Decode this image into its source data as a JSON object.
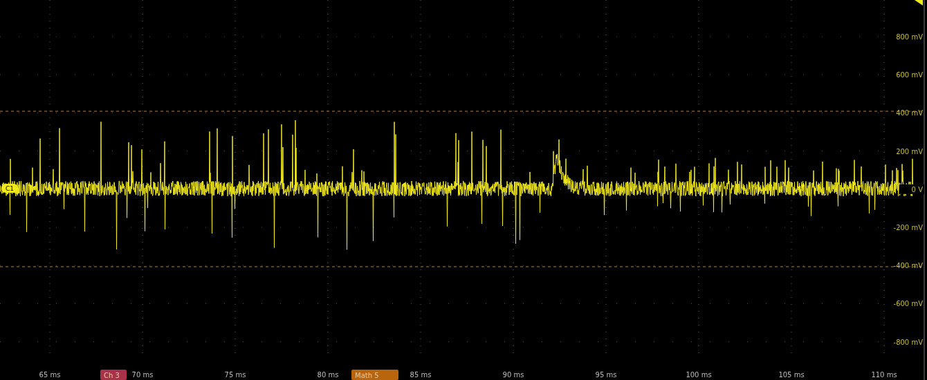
{
  "y_axis": {
    "ticks": [
      "800 mV",
      "600 mV",
      "400 mV",
      "200 mV",
      "0 V",
      "-200 mV",
      "-400 mV",
      "-600 mV",
      "-800 mV"
    ]
  },
  "x_axis": {
    "ticks": [
      "65 ms",
      "70 ms",
      "75 ms",
      "80 ms",
      "85 ms",
      "90 ms",
      "95 ms",
      "100 ms",
      "105 ms",
      "110 ms"
    ]
  },
  "channel_marker": {
    "label": "C1"
  },
  "badges": [
    {
      "label": "Ch 3",
      "color": "#a8324a"
    },
    {
      "label": "Math 5",
      "color": "#b8650e"
    }
  ]
}
